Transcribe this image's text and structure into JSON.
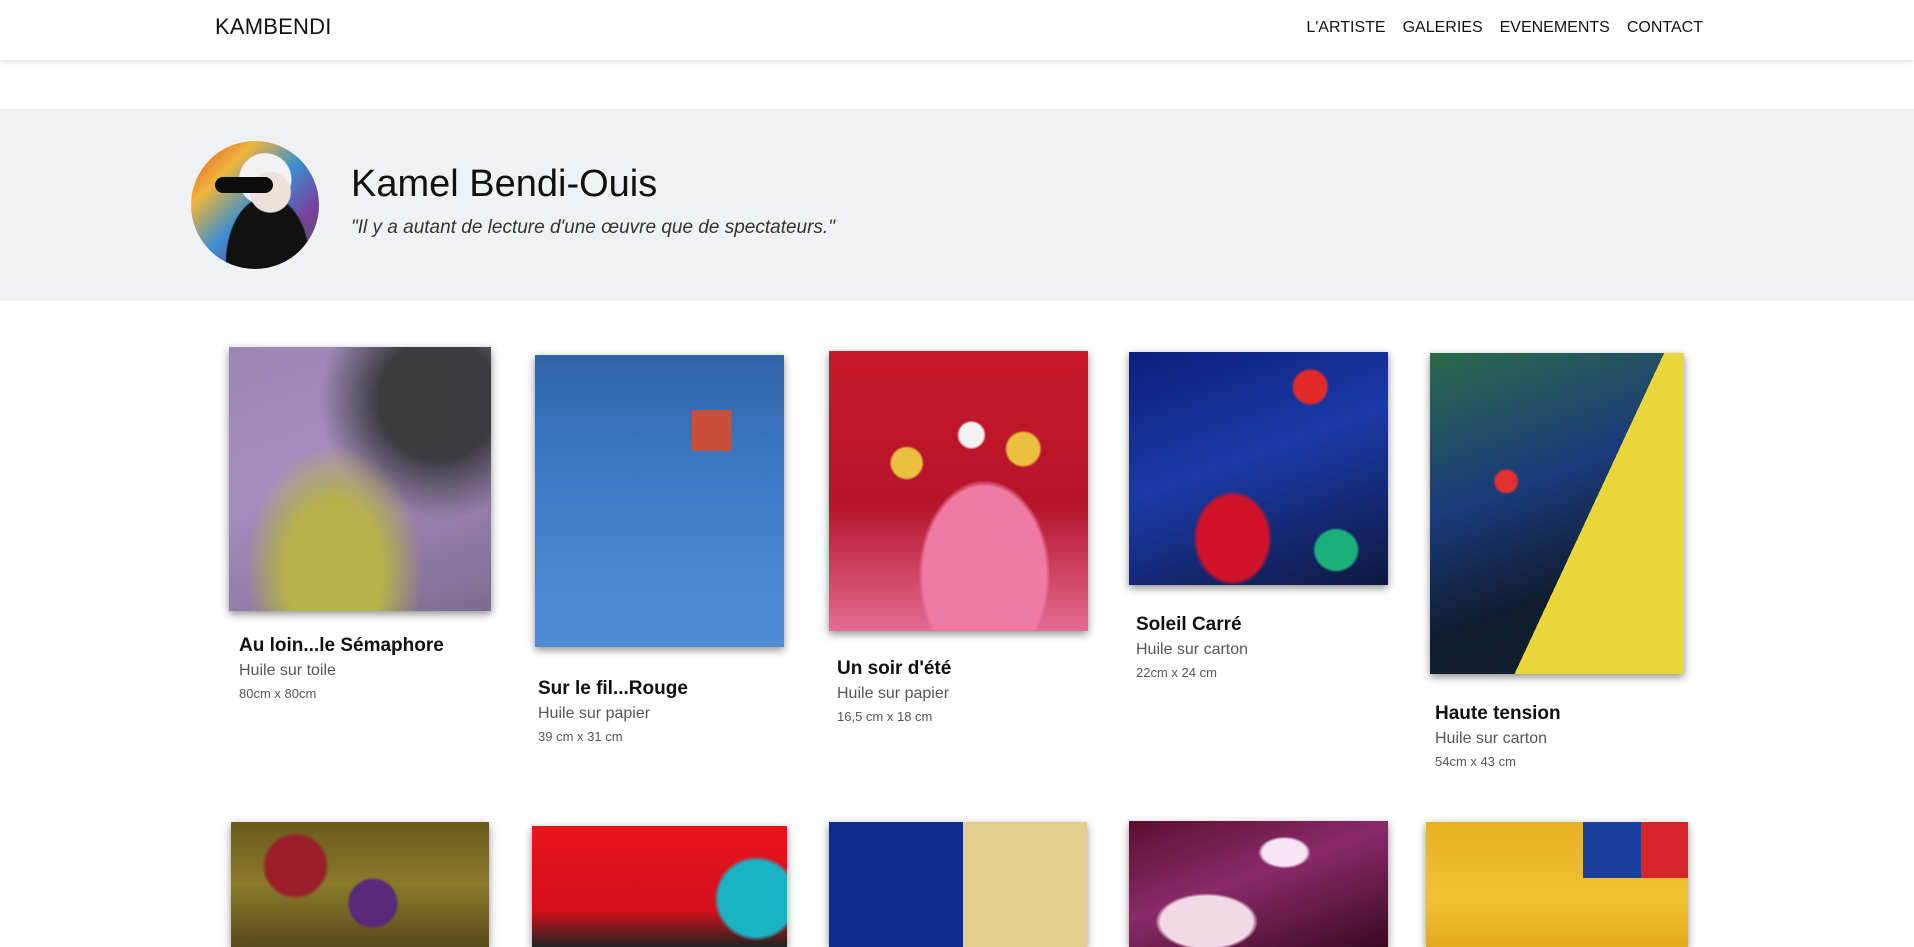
{
  "nav": {
    "brand": "KAMBENDI",
    "links": [
      "L'ARTISTE",
      "GALERIES",
      "EVENEMENTS",
      "CONTACT"
    ]
  },
  "artist": {
    "name": "Kamel Bendi-Ouis",
    "quote": "\"Il y a autant de lecture d'une œuvre que de spectateurs.\""
  },
  "artworks": [
    {
      "title": "Au loin...le Sémaphore",
      "medium": "Huile sur toile",
      "dimensions": "80cm x 80cm"
    },
    {
      "title": "Sur le fil...Rouge",
      "medium": "Huile sur papier",
      "dimensions": "39 cm x 31 cm"
    },
    {
      "title": "Un soir d'été",
      "medium": "Huile sur papier",
      "dimensions": "16,5 cm x 18 cm"
    },
    {
      "title": "Soleil Carré",
      "medium": "Huile sur carton",
      "dimensions": "22cm x 24 cm"
    },
    {
      "title": "Haute tension",
      "medium": "Huile sur carton",
      "dimensions": "54cm x 43 cm"
    }
  ]
}
